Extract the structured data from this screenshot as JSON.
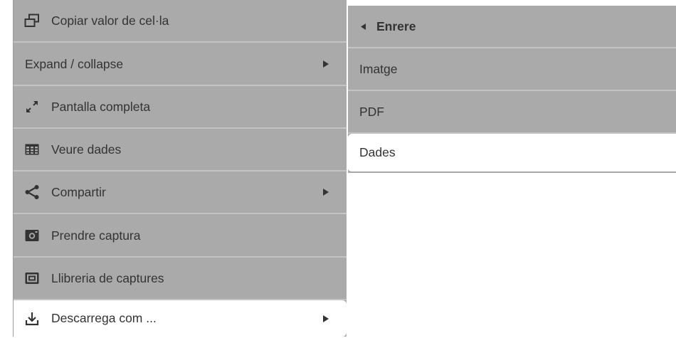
{
  "context_menu": {
    "items": [
      {
        "label": "Copiar valor de cel·la",
        "icon": "copy-icon",
        "has_submenu": false
      },
      {
        "label": "Expand / collapse",
        "icon": null,
        "has_submenu": true
      },
      {
        "label": "Pantalla completa",
        "icon": "fullscreen-icon",
        "has_submenu": false
      },
      {
        "label": "Veure dades",
        "icon": "table-icon",
        "has_submenu": false
      },
      {
        "label": "Compartir",
        "icon": "share-icon",
        "has_submenu": true
      },
      {
        "label": "Prendre captura",
        "icon": "camera-icon",
        "has_submenu": false
      },
      {
        "label": "Llibreria de captures",
        "icon": "snapshot-library-icon",
        "has_submenu": false
      },
      {
        "label": "Descarrega com ...",
        "icon": "download-icon",
        "has_submenu": true,
        "active": true
      }
    ]
  },
  "submenu": {
    "back_label": "Enrere",
    "items": [
      {
        "label": "Imatge"
      },
      {
        "label": "PDF"
      },
      {
        "label": "Dades",
        "active": true
      }
    ]
  },
  "colors": {
    "menu_background": "#aaaaaa",
    "separator": "#c4c4c4",
    "text": "#333333",
    "active_background": "#ffffff"
  }
}
